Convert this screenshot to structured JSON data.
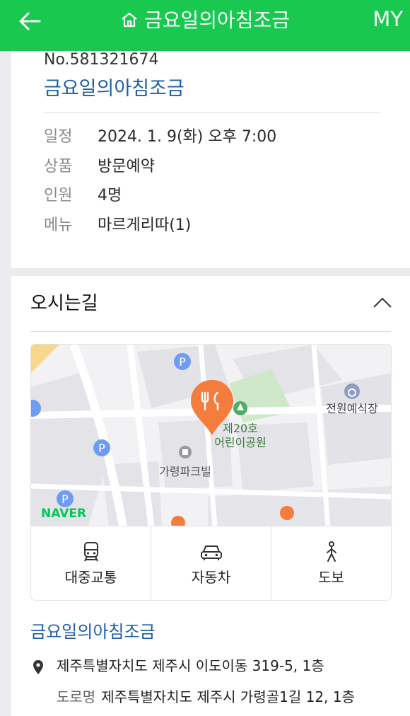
{
  "header": {
    "title": "금요일의아침조금",
    "my_label": "MY"
  },
  "reservation": {
    "number": "No.581321674",
    "shop_name": "금요일의아침조금",
    "rows": [
      {
        "label": "일정",
        "value": "2024. 1. 9(화) 오후 7:00"
      },
      {
        "label": "상품",
        "value": "방문예약"
      },
      {
        "label": "인원",
        "value": "4명"
      },
      {
        "label": "메뉴",
        "value": "마르게리따(1)"
      }
    ]
  },
  "directions": {
    "title": "오시는길",
    "map": {
      "park_label_1": "제20호",
      "park_label_2": "어린이공원",
      "building_label": "가령파크빌",
      "wedding_label": "전원예식장",
      "naver_logo": "NAVER",
      "parking_symbol": "P"
    },
    "transport": [
      {
        "label": "대중교통",
        "icon": "bus-icon"
      },
      {
        "label": "자동차",
        "icon": "car-icon"
      },
      {
        "label": "도보",
        "icon": "walk-icon"
      }
    ],
    "address_title": "금요일의아침조금",
    "address": "제주특별자치도 제주시 이도이동 319-5, 1층",
    "road_label": "도로명",
    "road_address": "제주특별자치도 제주시 가령골1길 12, 1층"
  },
  "colors": {
    "brand_green": "#19c94f",
    "link_blue": "#1d5fa8",
    "pin_orange": "#f47c3c"
  }
}
